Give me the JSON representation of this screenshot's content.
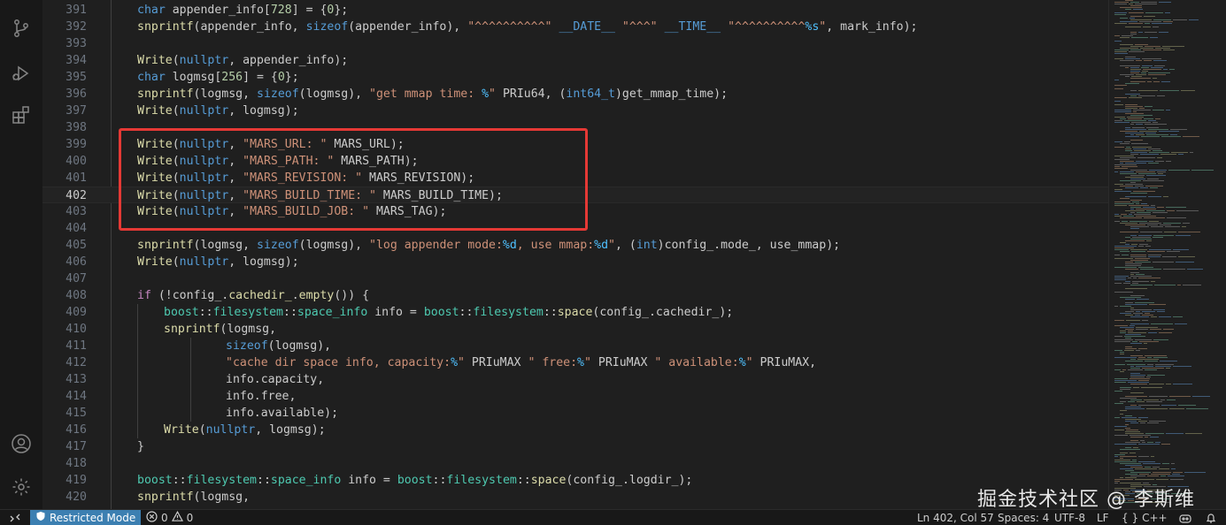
{
  "activity_bar": {
    "icons": [
      "source-control-icon",
      "run-debug-icon",
      "extensions-icon",
      "account-icon",
      "settings-icon"
    ]
  },
  "editor": {
    "current_line": "402",
    "highlight_color": "#e53935",
    "lines": [
      {
        "num": "391",
        "indent": 0,
        "tokens": [
          [
            "k",
            "char"
          ],
          [
            "p",
            " appender_info["
          ],
          [
            "n",
            "728"
          ],
          [
            "p",
            "] = {"
          ],
          [
            "n",
            "0"
          ],
          [
            "p",
            "};"
          ]
        ]
      },
      {
        "num": "392",
        "indent": 0,
        "tokens": [
          [
            "f",
            "snprintf"
          ],
          [
            "p",
            "(appender_info, "
          ],
          [
            "k",
            "sizeof"
          ],
          [
            "p",
            "(appender_info), "
          ],
          [
            "s",
            "\"^^^^^^^^^^\""
          ],
          [
            "p",
            " "
          ],
          [
            "mac",
            "__DATE__"
          ],
          [
            "p",
            " "
          ],
          [
            "s",
            "\"^^^\""
          ],
          [
            "p",
            " "
          ],
          [
            "mac",
            "__TIME__"
          ],
          [
            "p",
            " "
          ],
          [
            "s",
            "\"^^^^^^^^^^"
          ],
          [
            "c",
            "%s"
          ],
          [
            "s",
            "\""
          ],
          [
            "p",
            ", mark_info);"
          ]
        ]
      },
      {
        "num": "393",
        "indent": 0,
        "tokens": []
      },
      {
        "num": "394",
        "indent": 0,
        "tokens": [
          [
            "f",
            "Write"
          ],
          [
            "p",
            "("
          ],
          [
            "k",
            "nullptr"
          ],
          [
            "p",
            ", appender_info);"
          ]
        ]
      },
      {
        "num": "395",
        "indent": 0,
        "tokens": [
          [
            "k",
            "char"
          ],
          [
            "p",
            " logmsg["
          ],
          [
            "n",
            "256"
          ],
          [
            "p",
            "] = {"
          ],
          [
            "n",
            "0"
          ],
          [
            "p",
            "};"
          ]
        ]
      },
      {
        "num": "396",
        "indent": 0,
        "tokens": [
          [
            "f",
            "snprintf"
          ],
          [
            "p",
            "(logmsg, "
          ],
          [
            "k",
            "sizeof"
          ],
          [
            "p",
            "(logmsg), "
          ],
          [
            "s",
            "\"get mmap time: "
          ],
          [
            "c",
            "%"
          ],
          [
            "s",
            "\""
          ],
          [
            "p",
            " PRIu64, ("
          ],
          [
            "k",
            "int64_t"
          ],
          [
            "p",
            ")get_mmap_time);"
          ]
        ]
      },
      {
        "num": "397",
        "indent": 0,
        "tokens": [
          [
            "f",
            "Write"
          ],
          [
            "p",
            "("
          ],
          [
            "k",
            "nullptr"
          ],
          [
            "p",
            ", logmsg);"
          ]
        ]
      },
      {
        "num": "398",
        "indent": 0,
        "tokens": []
      },
      {
        "num": "399",
        "indent": 0,
        "tokens": [
          [
            "f",
            "Write"
          ],
          [
            "p",
            "("
          ],
          [
            "k",
            "nullptr"
          ],
          [
            "p",
            ", "
          ],
          [
            "s",
            "\"MARS_URL: \""
          ],
          [
            "p",
            " MARS_URL);"
          ]
        ]
      },
      {
        "num": "400",
        "indent": 0,
        "tokens": [
          [
            "f",
            "Write"
          ],
          [
            "p",
            "("
          ],
          [
            "k",
            "nullptr"
          ],
          [
            "p",
            ", "
          ],
          [
            "s",
            "\"MARS_PATH: \""
          ],
          [
            "p",
            " MARS_PATH);"
          ]
        ]
      },
      {
        "num": "401",
        "indent": 0,
        "tokens": [
          [
            "f",
            "Write"
          ],
          [
            "p",
            "("
          ],
          [
            "k",
            "nullptr"
          ],
          [
            "p",
            ", "
          ],
          [
            "s",
            "\"MARS_REVISION: \""
          ],
          [
            "p",
            " MARS_REVISION);"
          ]
        ]
      },
      {
        "num": "402",
        "indent": 0,
        "tokens": [
          [
            "f",
            "Write"
          ],
          [
            "p",
            "("
          ],
          [
            "k",
            "nullptr"
          ],
          [
            "p",
            ", "
          ],
          [
            "s",
            "\"MARS_BUILD_TIME: \""
          ],
          [
            "p",
            " MARS_BUILD_TIME);"
          ]
        ]
      },
      {
        "num": "403",
        "indent": 0,
        "tokens": [
          [
            "f",
            "Write"
          ],
          [
            "p",
            "("
          ],
          [
            "k",
            "nullptr"
          ],
          [
            "p",
            ", "
          ],
          [
            "s",
            "\"MARS_BUILD_JOB: \""
          ],
          [
            "p",
            " MARS_TAG);"
          ]
        ]
      },
      {
        "num": "404",
        "indent": 0,
        "tokens": []
      },
      {
        "num": "405",
        "indent": 0,
        "tokens": [
          [
            "f",
            "snprintf"
          ],
          [
            "p",
            "(logmsg, "
          ],
          [
            "k",
            "sizeof"
          ],
          [
            "p",
            "(logmsg), "
          ],
          [
            "s",
            "\"log appender mode:"
          ],
          [
            "c",
            "%d"
          ],
          [
            "s",
            ", use mmap:"
          ],
          [
            "c",
            "%d"
          ],
          [
            "s",
            "\""
          ],
          [
            "p",
            ", ("
          ],
          [
            "k",
            "int"
          ],
          [
            "p",
            ")config_.mode_, use_mmap);"
          ]
        ]
      },
      {
        "num": "406",
        "indent": 0,
        "tokens": [
          [
            "f",
            "Write"
          ],
          [
            "p",
            "("
          ],
          [
            "k",
            "nullptr"
          ],
          [
            "p",
            ", logmsg);"
          ]
        ]
      },
      {
        "num": "407",
        "indent": 0,
        "tokens": []
      },
      {
        "num": "408",
        "indent": 0,
        "tokens": [
          [
            "m",
            "if"
          ],
          [
            "p",
            " (!config_."
          ],
          [
            "f",
            "cachedir_"
          ],
          [
            "p",
            "."
          ],
          [
            "f",
            "empty"
          ],
          [
            "p",
            "()) {"
          ]
        ]
      },
      {
        "num": "409",
        "indent": 1,
        "tokens": [
          [
            "t",
            "boost"
          ],
          [
            "p",
            "::"
          ],
          [
            "t",
            "filesystem"
          ],
          [
            "p",
            "::"
          ],
          [
            "t",
            "space_info"
          ],
          [
            "p",
            " info = "
          ],
          [
            "t",
            "boost"
          ],
          [
            "p",
            "::"
          ],
          [
            "t",
            "filesystem"
          ],
          [
            "p",
            "::"
          ],
          [
            "f",
            "space"
          ],
          [
            "p",
            "(config_.cachedir_);"
          ]
        ]
      },
      {
        "num": "410",
        "indent": 1,
        "tokens": [
          [
            "f",
            "snprintf"
          ],
          [
            "p",
            "(logmsg,"
          ]
        ]
      },
      {
        "num": "411",
        "indent": 2,
        "tokens": [
          [
            "k",
            "sizeof"
          ],
          [
            "p",
            "(logmsg),"
          ]
        ]
      },
      {
        "num": "412",
        "indent": 2,
        "tokens": [
          [
            "s",
            "\"cache dir space info, capacity:"
          ],
          [
            "c",
            "%"
          ],
          [
            "s",
            "\""
          ],
          [
            "p",
            " PRIuMAX "
          ],
          [
            "s",
            "\" free:"
          ],
          [
            "c",
            "%"
          ],
          [
            "s",
            "\""
          ],
          [
            "p",
            " PRIuMAX "
          ],
          [
            "s",
            "\" available:"
          ],
          [
            "c",
            "%"
          ],
          [
            "s",
            "\""
          ],
          [
            "p",
            " PRIuMAX,"
          ]
        ]
      },
      {
        "num": "413",
        "indent": 2,
        "tokens": [
          [
            "p",
            "info.capacity,"
          ]
        ]
      },
      {
        "num": "414",
        "indent": 2,
        "tokens": [
          [
            "p",
            "info.free,"
          ]
        ]
      },
      {
        "num": "415",
        "indent": 2,
        "tokens": [
          [
            "p",
            "info.available);"
          ]
        ]
      },
      {
        "num": "416",
        "indent": 1,
        "tokens": [
          [
            "f",
            "Write"
          ],
          [
            "p",
            "("
          ],
          [
            "k",
            "nullptr"
          ],
          [
            "p",
            ", logmsg);"
          ]
        ]
      },
      {
        "num": "417",
        "indent": 0,
        "tokens": [
          [
            "p",
            "}"
          ]
        ]
      },
      {
        "num": "418",
        "indent": 0,
        "tokens": []
      },
      {
        "num": "419",
        "indent": 0,
        "tokens": [
          [
            "t",
            "boost"
          ],
          [
            "p",
            "::"
          ],
          [
            "t",
            "filesystem"
          ],
          [
            "p",
            "::"
          ],
          [
            "t",
            "space_info"
          ],
          [
            "p",
            " info = "
          ],
          [
            "t",
            "boost"
          ],
          [
            "p",
            "::"
          ],
          [
            "t",
            "filesystem"
          ],
          [
            "p",
            "::"
          ],
          [
            "f",
            "space"
          ],
          [
            "p",
            "(config_.logdir_);"
          ]
        ]
      },
      {
        "num": "420",
        "indent": 0,
        "tokens": [
          [
            "f",
            "snprintf"
          ],
          [
            "p",
            "(logmsg,"
          ]
        ]
      }
    ]
  },
  "statusbar": {
    "restricted_mode": "Restricted Mode",
    "errors": "0",
    "warnings": "0",
    "cursor": "Ln 402, Col 57",
    "spaces": "Spaces: 4",
    "encoding": "UTF-8",
    "eol": "LF",
    "language": "C++",
    "language_brace": "{ }",
    "accent": "#3c7fb1"
  },
  "watermark": "掘金技术社区 @ 李斯维"
}
